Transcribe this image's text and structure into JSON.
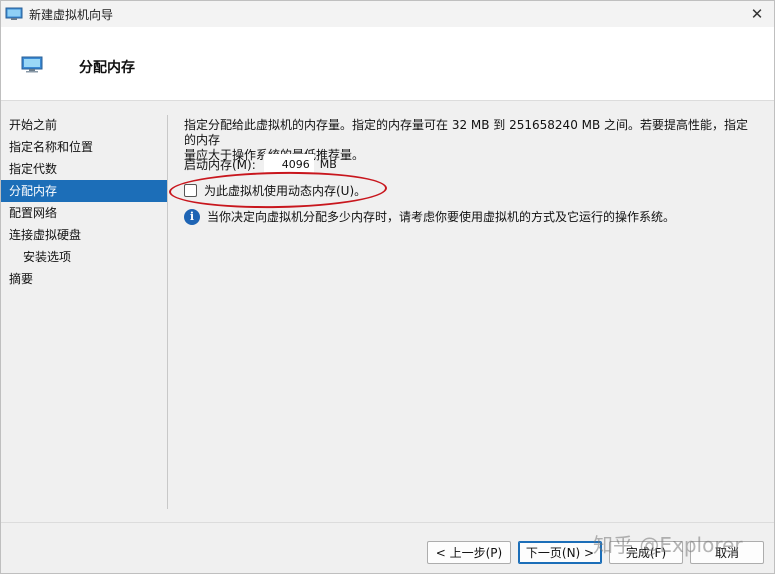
{
  "window": {
    "title": "新建虚拟机向导",
    "close_glyph": "✕"
  },
  "header": {
    "title": "分配内存"
  },
  "sidebar": {
    "items": [
      {
        "label": "开始之前"
      },
      {
        "label": "指定名称和位置"
      },
      {
        "label": "指定代数"
      },
      {
        "label": "分配内存"
      },
      {
        "label": "配置网络"
      },
      {
        "label": "连接虚拟硬盘"
      },
      {
        "label": "安装选项"
      },
      {
        "label": "摘要"
      }
    ],
    "active_index": 3
  },
  "content": {
    "description_line1": "指定分配给此虚拟机的内存量。指定的内存量可在 32 MB 到 251658240 MB 之间。若要提高性能，指定的内存",
    "description_line2": "量应大于操作系统的最低推荐量。",
    "memory_label": "启动内存(M):",
    "memory_value": "4096",
    "memory_unit": "MB",
    "dynamic_memory_label": "为此虚拟机使用动态内存(U)。",
    "dynamic_memory_checked": false,
    "info_text": "当你决定向虚拟机分配多少内存时，请考虑你要使用虚拟机的方式及它运行的操作系统。"
  },
  "buttons": {
    "prev": "< 上一步(P)",
    "next": "下一页(N) >",
    "finish": "完成(F)",
    "cancel": "取消"
  },
  "watermark": "知乎 @Explorer",
  "colors": {
    "accent": "#1c6eb8",
    "annotation_red": "#c8161d",
    "info_blue": "#1e64b4"
  }
}
